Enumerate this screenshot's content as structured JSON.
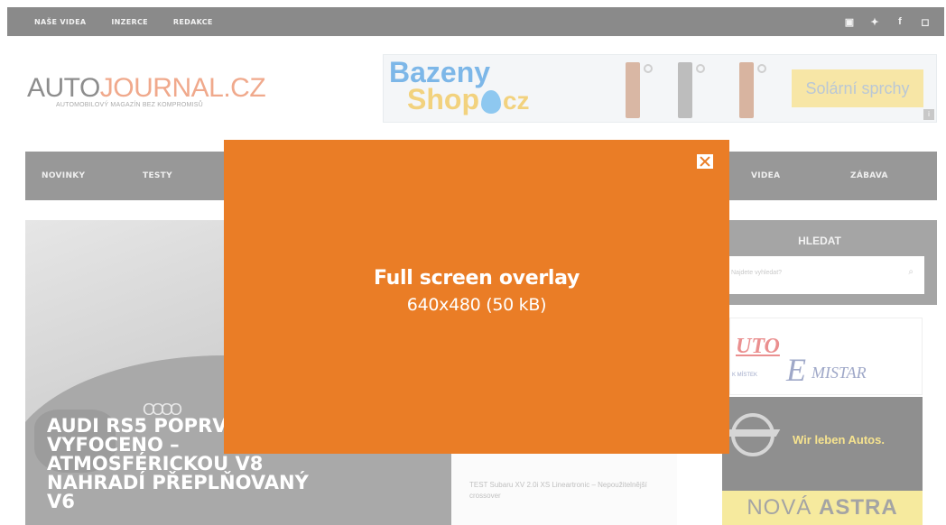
{
  "top_bar": {
    "nav": [
      "NAŠE VIDEA",
      "INZERCE",
      "REDAKCE"
    ],
    "social_icons": [
      "youtube-icon",
      "twitter-icon",
      "facebook-icon",
      "instagram-icon"
    ],
    "social_glyphs": [
      "▣",
      "✦",
      "f",
      "◻"
    ]
  },
  "logo": {
    "auto": "AUTO",
    "journal": "JOURNAL.CZ",
    "tagline": "AUTOMOBILOVÝ MAGAZÍN BEZ KOMPROMISŮ"
  },
  "ad_banner": {
    "brand_line1": "Bazeny",
    "brand_line2": "Shop",
    "brand_tld": "cz",
    "cta": "Solární sprchy",
    "info": "i"
  },
  "main_nav": {
    "items": [
      "NOVINKY",
      "TESTY",
      "VIDEA",
      "ZÁBAVA"
    ]
  },
  "hero": {
    "rings": "OOOO",
    "title": "AUDI RS5 POPRVÉ VYFOCENO – ATMOSFÉRICKOU V8 NAHRADÍ PŘEPLŇOVANÝ V6"
  },
  "center_col": {
    "article": "TEST Subaru XV 2.0i XS Lineartronic – Nepoužitelnější crossover"
  },
  "sidebar": {
    "search_title": "HLEDAT",
    "search_placeholder": "Najdete vyhledat?",
    "search_icon": "⌕",
    "ad1": {
      "part1": "UTO",
      "part2": "E",
      "part3": "MISTAR",
      "small": "K MÍSTEK"
    },
    "ad2": {
      "slogan": "Wir leben Autos.",
      "astra_light": "NOVÁ ",
      "astra_bold": "ASTRA"
    }
  },
  "overlay": {
    "title": "Full screen overlay",
    "subtitle": "640x480 (50 kB)",
    "close_icon": "close-icon"
  },
  "colors": {
    "overlay_bg": "#ea7d26",
    "overlay_text": "#ffffff"
  }
}
